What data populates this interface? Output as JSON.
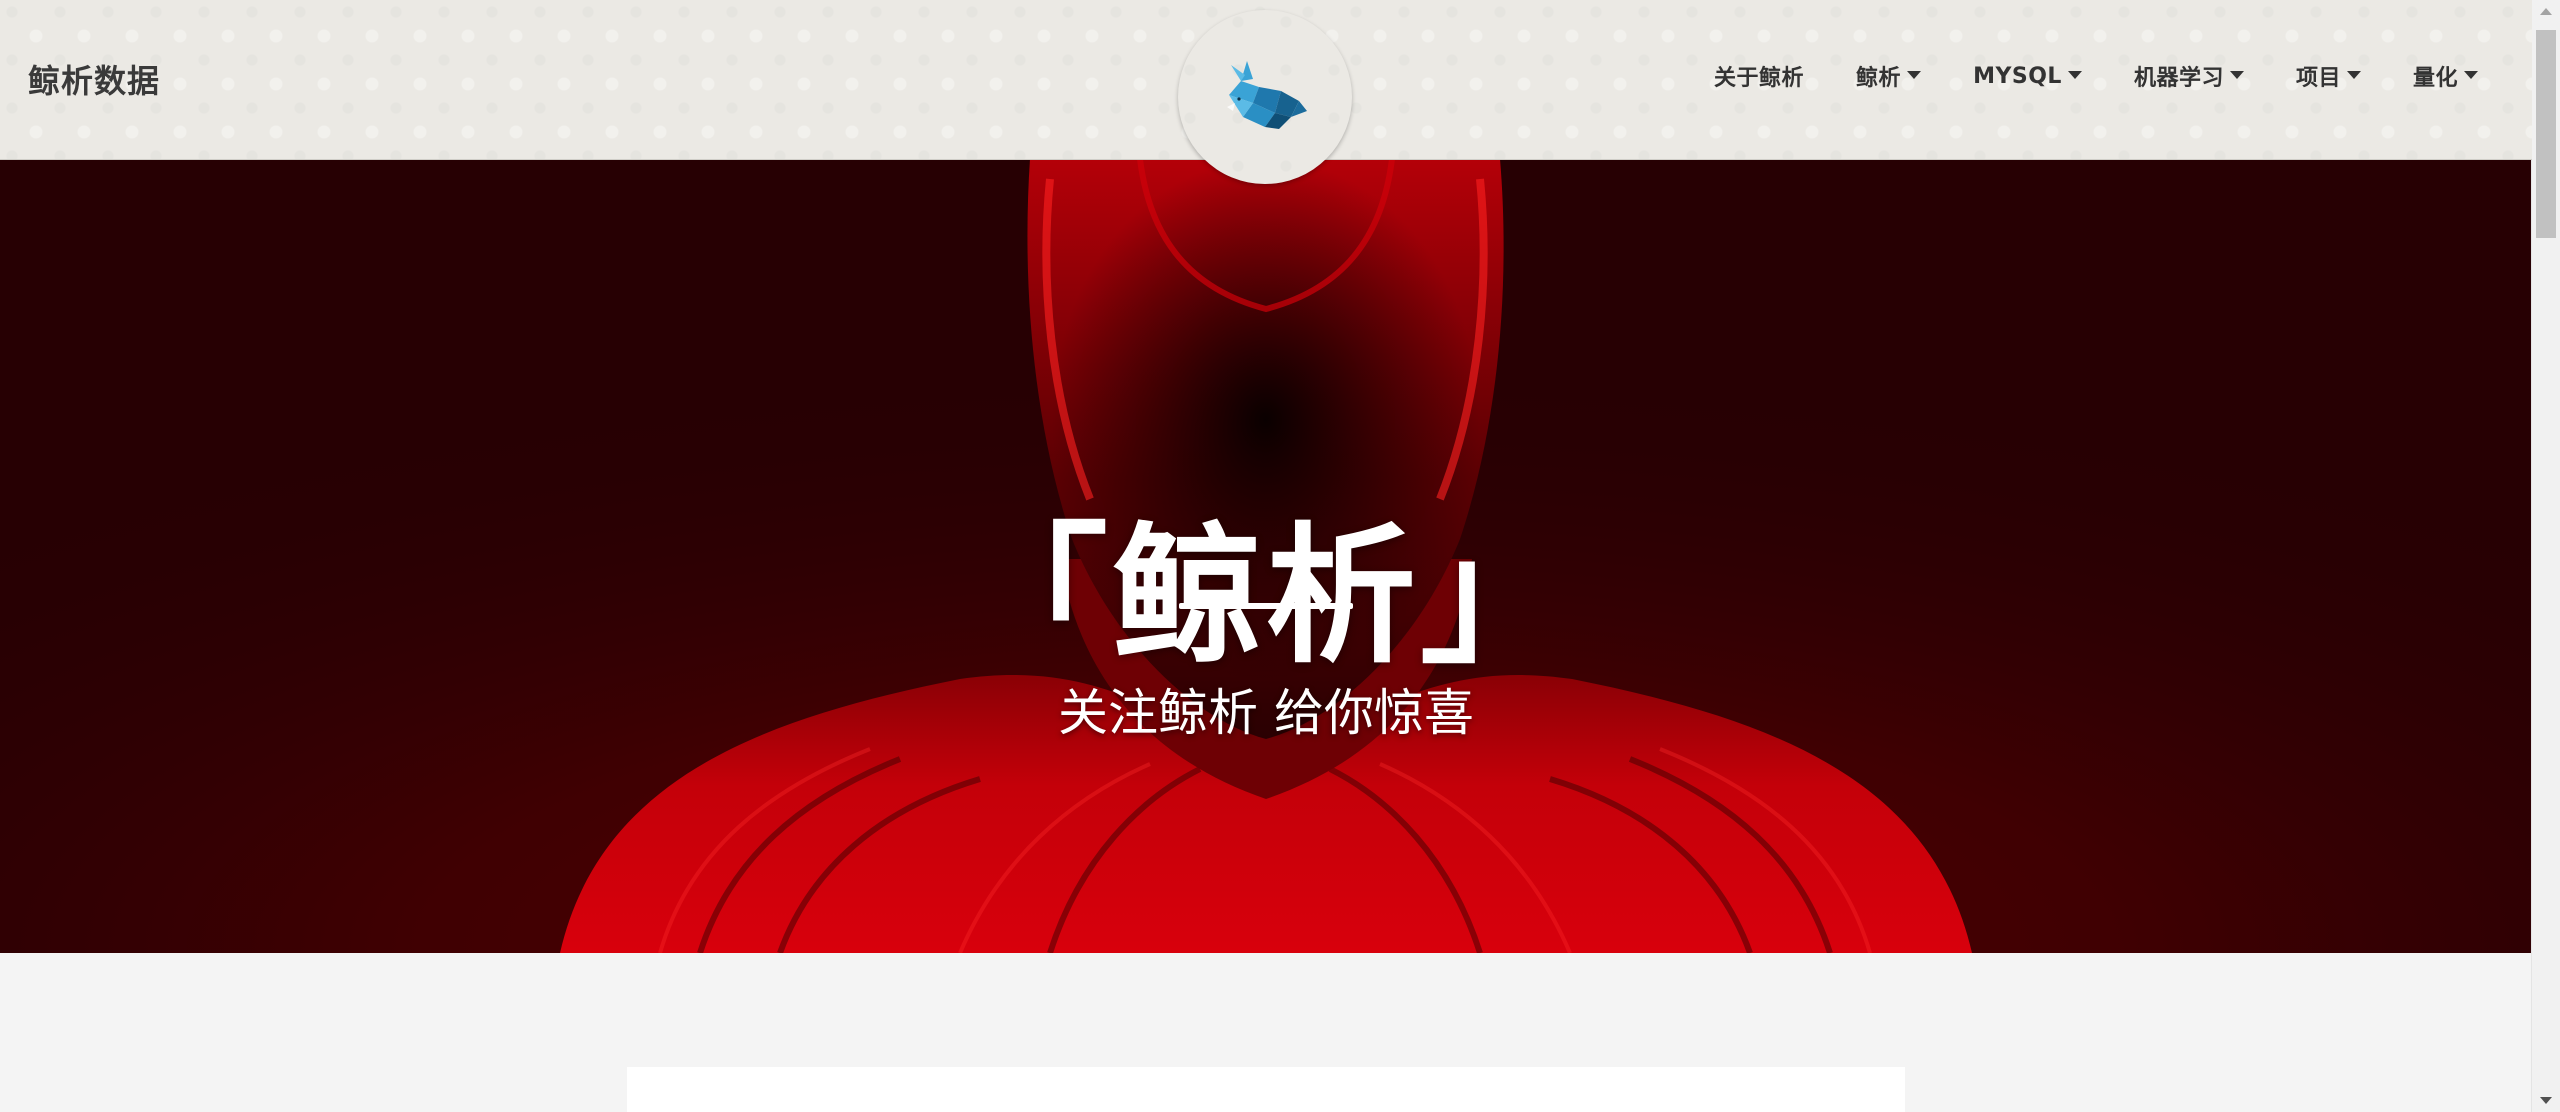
{
  "site": {
    "brand": "鲸析数据"
  },
  "nav": {
    "items": [
      {
        "label": "关于鲸析",
        "dropdown": false
      },
      {
        "label": "鲸析",
        "dropdown": true
      },
      {
        "label": "MYSQL",
        "dropdown": true
      },
      {
        "label": "机器学习",
        "dropdown": true
      },
      {
        "label": "项目",
        "dropdown": true
      },
      {
        "label": "量化",
        "dropdown": true
      }
    ]
  },
  "hero": {
    "title": "「鲸析」",
    "subtitle": "关注鲸析 给你惊喜"
  },
  "colors": {
    "navbar_bg": "#ebe9e4",
    "hero_dark": "#270003",
    "hero_red": "#c00000",
    "logo_blue": "#2a86b8"
  },
  "icons": {
    "logo": "whale-logo-icon",
    "caret": "caret-down-icon"
  }
}
